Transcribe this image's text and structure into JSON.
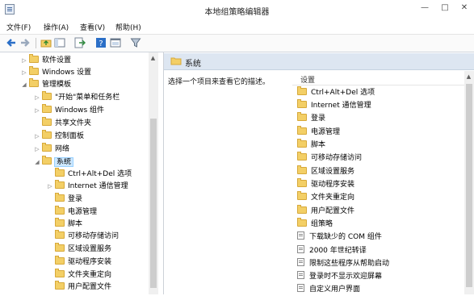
{
  "window": {
    "title": "本地组策略编辑器",
    "controls": {
      "minimize": "—",
      "maximize": "□",
      "close": "✕"
    }
  },
  "menu": [
    "文件(F)",
    "操作(A)",
    "查看(V)",
    "帮助(H)"
  ],
  "toolbar": [
    "back-icon",
    "forward-icon",
    "up-folder-icon",
    "show-hide-tree-icon",
    "export-list-icon",
    "help-icon",
    "properties-icon",
    "filter-icon"
  ],
  "tree": {
    "items": [
      {
        "label": "软件设置",
        "expander": "▷"
      },
      {
        "label": "Windows 设置",
        "expander": "▷"
      },
      {
        "label": "管理模板",
        "expander": "◢"
      },
      {
        "label": "\"开始\"菜单和任务栏",
        "expander": "▷"
      },
      {
        "label": "Windows 组件",
        "expander": "▷"
      },
      {
        "label": "共享文件夹",
        "expander": ""
      },
      {
        "label": "控制面板",
        "expander": "▷"
      },
      {
        "label": "网络",
        "expander": "▷"
      },
      {
        "label": "系统",
        "expander": "◢"
      },
      {
        "label": "Ctrl+Alt+Del 选项",
        "expander": ""
      },
      {
        "label": "Internet 通信管理",
        "expander": "▷"
      },
      {
        "label": "登录",
        "expander": ""
      },
      {
        "label": "电源管理",
        "expander": ""
      },
      {
        "label": "脚本",
        "expander": ""
      },
      {
        "label": "可移动存储访问",
        "expander": ""
      },
      {
        "label": "区域设置服务",
        "expander": ""
      },
      {
        "label": "驱动程序安装",
        "expander": ""
      },
      {
        "label": "文件夹重定向",
        "expander": ""
      },
      {
        "label": "用户配置文件",
        "expander": ""
      }
    ]
  },
  "content": {
    "header_title": "系统",
    "description": "选择一个项目来查看它的描述。",
    "list_column": "设置",
    "items": [
      {
        "label": "Ctrl+Alt+Del 选项",
        "type": "folder"
      },
      {
        "label": "Internet 通信管理",
        "type": "folder"
      },
      {
        "label": "登录",
        "type": "folder"
      },
      {
        "label": "电源管理",
        "type": "folder"
      },
      {
        "label": "脚本",
        "type": "folder"
      },
      {
        "label": "可移动存储访问",
        "type": "folder"
      },
      {
        "label": "区域设置服务",
        "type": "folder"
      },
      {
        "label": "驱动程序安装",
        "type": "folder"
      },
      {
        "label": "文件夹重定向",
        "type": "folder"
      },
      {
        "label": "用户配置文件",
        "type": "folder"
      },
      {
        "label": "组策略",
        "type": "folder"
      },
      {
        "label": "下载缺少的 COM 组件",
        "type": "setting"
      },
      {
        "label": "2000 年世纪转译",
        "type": "setting"
      },
      {
        "label": "限制这些程序从帮助启动",
        "type": "setting"
      },
      {
        "label": "登录时不显示欢迎屏幕",
        "type": "setting"
      },
      {
        "label": "自定义用户界面",
        "type": "setting"
      }
    ]
  },
  "colors": {
    "folder": "#f3cf66",
    "selection": "#cde8ff",
    "header_bg": "#dde6f1"
  }
}
